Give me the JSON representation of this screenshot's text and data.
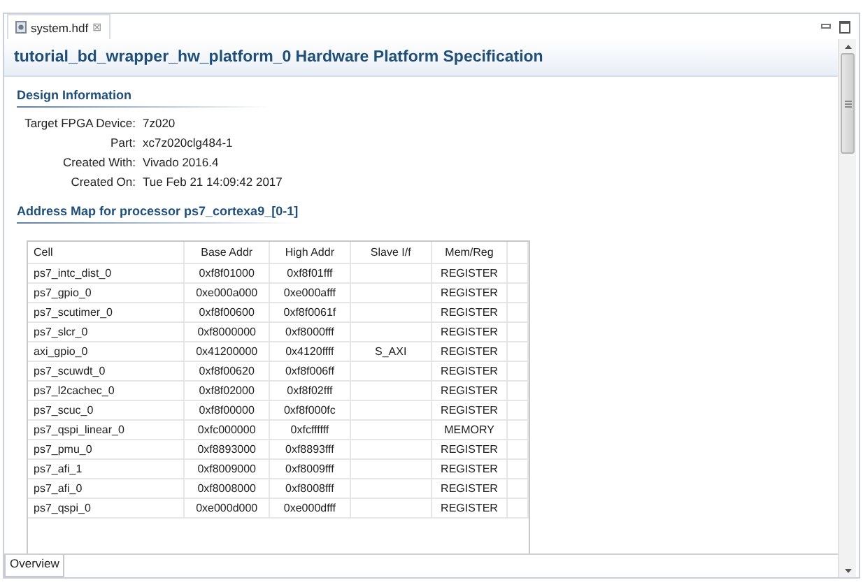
{
  "editor_tab": {
    "label": "system.hdf",
    "close": "⊠"
  },
  "title": "tutorial_bd_wrapper_hw_platform_0 Hardware Platform Specification",
  "design_info": {
    "heading": "Design Information",
    "fields": [
      {
        "label": "Target FPGA Device:",
        "value": "7z020"
      },
      {
        "label": "Part:",
        "value": "xc7z020clg484-1"
      },
      {
        "label": "Created With:",
        "value": "Vivado 2016.4"
      },
      {
        "label": "Created On:",
        "value": "Tue Feb 21 14:09:42 2017"
      }
    ]
  },
  "address_map": {
    "heading": "Address Map for processor ps7_cortexa9_[0-1]",
    "columns": [
      "Cell",
      "Base Addr",
      "High Addr",
      "Slave I/f",
      "Mem/Reg"
    ],
    "rows": [
      [
        "ps7_intc_dist_0",
        "0xf8f01000",
        "0xf8f01fff",
        "",
        "REGISTER"
      ],
      [
        "ps7_gpio_0",
        "0xe000a000",
        "0xe000afff",
        "",
        "REGISTER"
      ],
      [
        "ps7_scutimer_0",
        "0xf8f00600",
        "0xf8f0061f",
        "",
        "REGISTER"
      ],
      [
        "ps7_slcr_0",
        "0xf8000000",
        "0xf8000fff",
        "",
        "REGISTER"
      ],
      [
        "axi_gpio_0",
        "0x41200000",
        "0x4120ffff",
        "S_AXI",
        "REGISTER"
      ],
      [
        "ps7_scuwdt_0",
        "0xf8f00620",
        "0xf8f006ff",
        "",
        "REGISTER"
      ],
      [
        "ps7_l2cachec_0",
        "0xf8f02000",
        "0xf8f02fff",
        "",
        "REGISTER"
      ],
      [
        "ps7_scuc_0",
        "0xf8f00000",
        "0xf8f000fc",
        "",
        "REGISTER"
      ],
      [
        "ps7_qspi_linear_0",
        "0xfc000000",
        "0xfcffffff",
        "",
        "MEMORY"
      ],
      [
        "ps7_pmu_0",
        "0xf8893000",
        "0xf8893fff",
        "",
        "REGISTER"
      ],
      [
        "ps7_afi_1",
        "0xf8009000",
        "0xf8009fff",
        "",
        "REGISTER"
      ],
      [
        "ps7_afi_0",
        "0xf8008000",
        "0xf8008fff",
        "",
        "REGISTER"
      ],
      [
        "ps7_qspi_0",
        "0xe000d000",
        "0xe000dfff",
        "",
        "REGISTER"
      ]
    ]
  },
  "bottom_tabs": [
    {
      "label": "Overview",
      "selected": true
    }
  ]
}
